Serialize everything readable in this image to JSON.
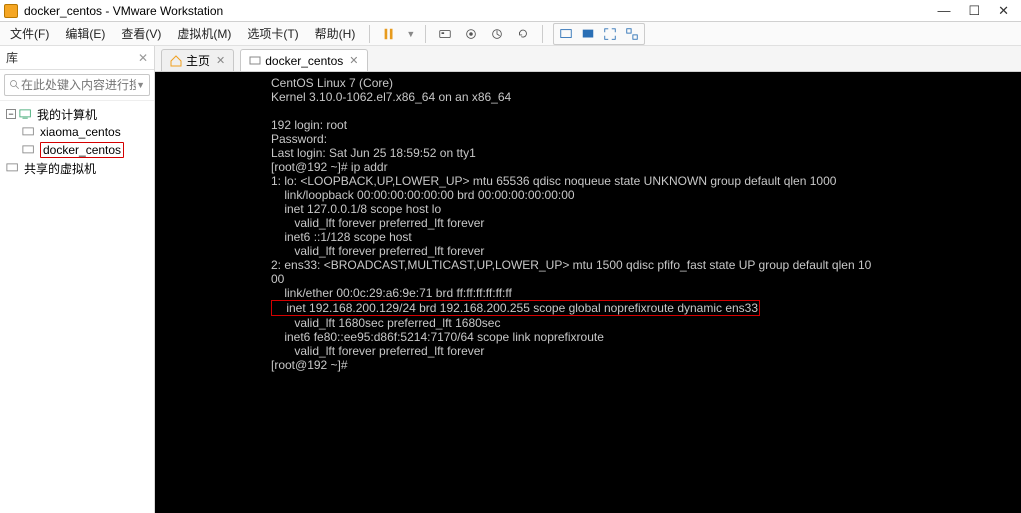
{
  "title": "docker_centos - VMware Workstation",
  "window_controls": {
    "min": "—",
    "max": "☐",
    "close": "✕"
  },
  "menu": {
    "file": "文件(F)",
    "edit": "编辑(E)",
    "view": "查看(V)",
    "vm": "虚拟机(M)",
    "tabs": "选项卡(T)",
    "help": "帮助(H)"
  },
  "sidebar": {
    "header": "库",
    "search_placeholder": "在此处键入内容进行搜...",
    "root": "我的计算机",
    "items": [
      {
        "label": "xiaoma_centos"
      },
      {
        "label": "docker_centos",
        "highlight": true
      }
    ],
    "shared": "共享的虚拟机"
  },
  "tabs_row": {
    "home": "主页",
    "vm": "docker_centos"
  },
  "terminal": {
    "line1": "CentOS Linux 7 (Core)",
    "line2": "Kernel 3.10.0-1062.el7.x86_64 on an x86_64",
    "line3": "",
    "line4": "192 login: root",
    "line5": "Password:",
    "line6": "Last login: Sat Jun 25 18:59:52 on tty1",
    "line7": "[root@192 ~]# ip addr",
    "line8": "1: lo: <LOOPBACK,UP,LOWER_UP> mtu 65536 qdisc noqueue state UNKNOWN group default qlen 1000",
    "line9": "    link/loopback 00:00:00:00:00:00 brd 00:00:00:00:00:00",
    "line10": "    inet 127.0.0.1/8 scope host lo",
    "line11": "       valid_lft forever preferred_lft forever",
    "line12": "    inet6 ::1/128 scope host",
    "line13": "       valid_lft forever preferred_lft forever",
    "line14": "2: ens33: <BROADCAST,MULTICAST,UP,LOWER_UP> mtu 1500 qdisc pfifo_fast state UP group default qlen 10",
    "line14b": "00",
    "line15": "    link/ether 00:0c:29:a6:9e:71 brd ff:ff:ff:ff:ff:ff",
    "line16": "    inet 192.168.200.129/24 brd 192.168.200.255 scope global noprefixroute dynamic ens33",
    "line17": "       valid_lft 1680sec preferred_lft 1680sec",
    "line18": "    inet6 fe80::ee95:d86f:5214:7170/64 scope link noprefixroute",
    "line19": "       valid_lft forever preferred_lft forever",
    "line20": "[root@192 ~]#"
  }
}
